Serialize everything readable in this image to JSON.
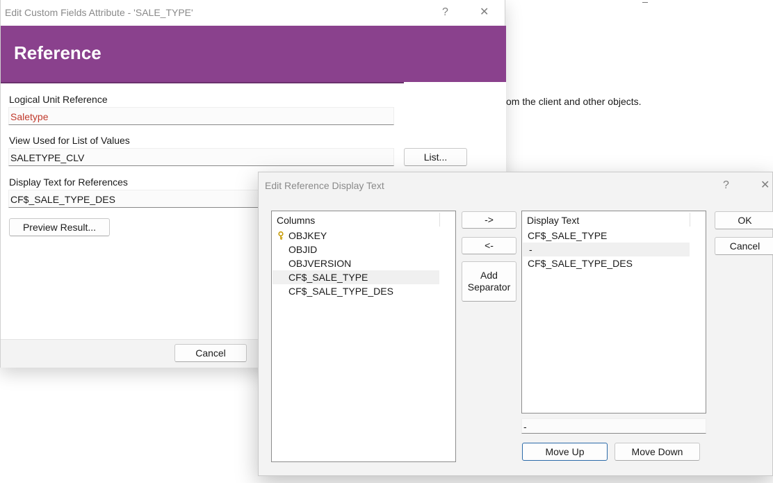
{
  "background": {
    "visible_text": "om the client and other objects."
  },
  "main_dialog": {
    "title": "Edit Custom Fields Attribute - 'SALE_TYPE'",
    "help_glyph": "?",
    "close_glyph": "✕",
    "banner_title": "Reference",
    "logical_unit_label": "Logical Unit Reference",
    "logical_unit_value": "Saletype",
    "view_label": "View Used for List of Values",
    "view_value": "SALETYPE_CLV",
    "list_button": "List...",
    "display_text_label": "Display Text for References",
    "display_text_value": "CF$_SALE_TYPE_DES",
    "preview_button": "Preview Result...",
    "cancel_button": "Cancel",
    "accent_color": "#8a418d"
  },
  "reference_dialog": {
    "title": "Edit Reference Display Text",
    "help_glyph": "?",
    "close_glyph": "✕",
    "columns_header": "Columns",
    "columns": [
      {
        "label": "OBJKEY",
        "icon": "key-icon"
      },
      {
        "label": "OBJID"
      },
      {
        "label": "OBJVERSION"
      },
      {
        "label": "CF$_SALE_TYPE",
        "selected": true
      },
      {
        "label": "CF$_SALE_TYPE_DES"
      }
    ],
    "add_button": "->",
    "remove_button": "<-",
    "add_separator_line1": "Add",
    "add_separator_line2": "Separator",
    "display_header": "Display Text",
    "display_items": [
      {
        "label": "CF$_SALE_TYPE"
      },
      {
        "label": "-",
        "selected": true
      },
      {
        "label": "CF$_SALE_TYPE_DES"
      }
    ],
    "separator_value": "-",
    "move_up_button": "Move Up",
    "move_down_button": "Move Down",
    "ok_button": "OK",
    "cancel_button": "Cancel"
  }
}
